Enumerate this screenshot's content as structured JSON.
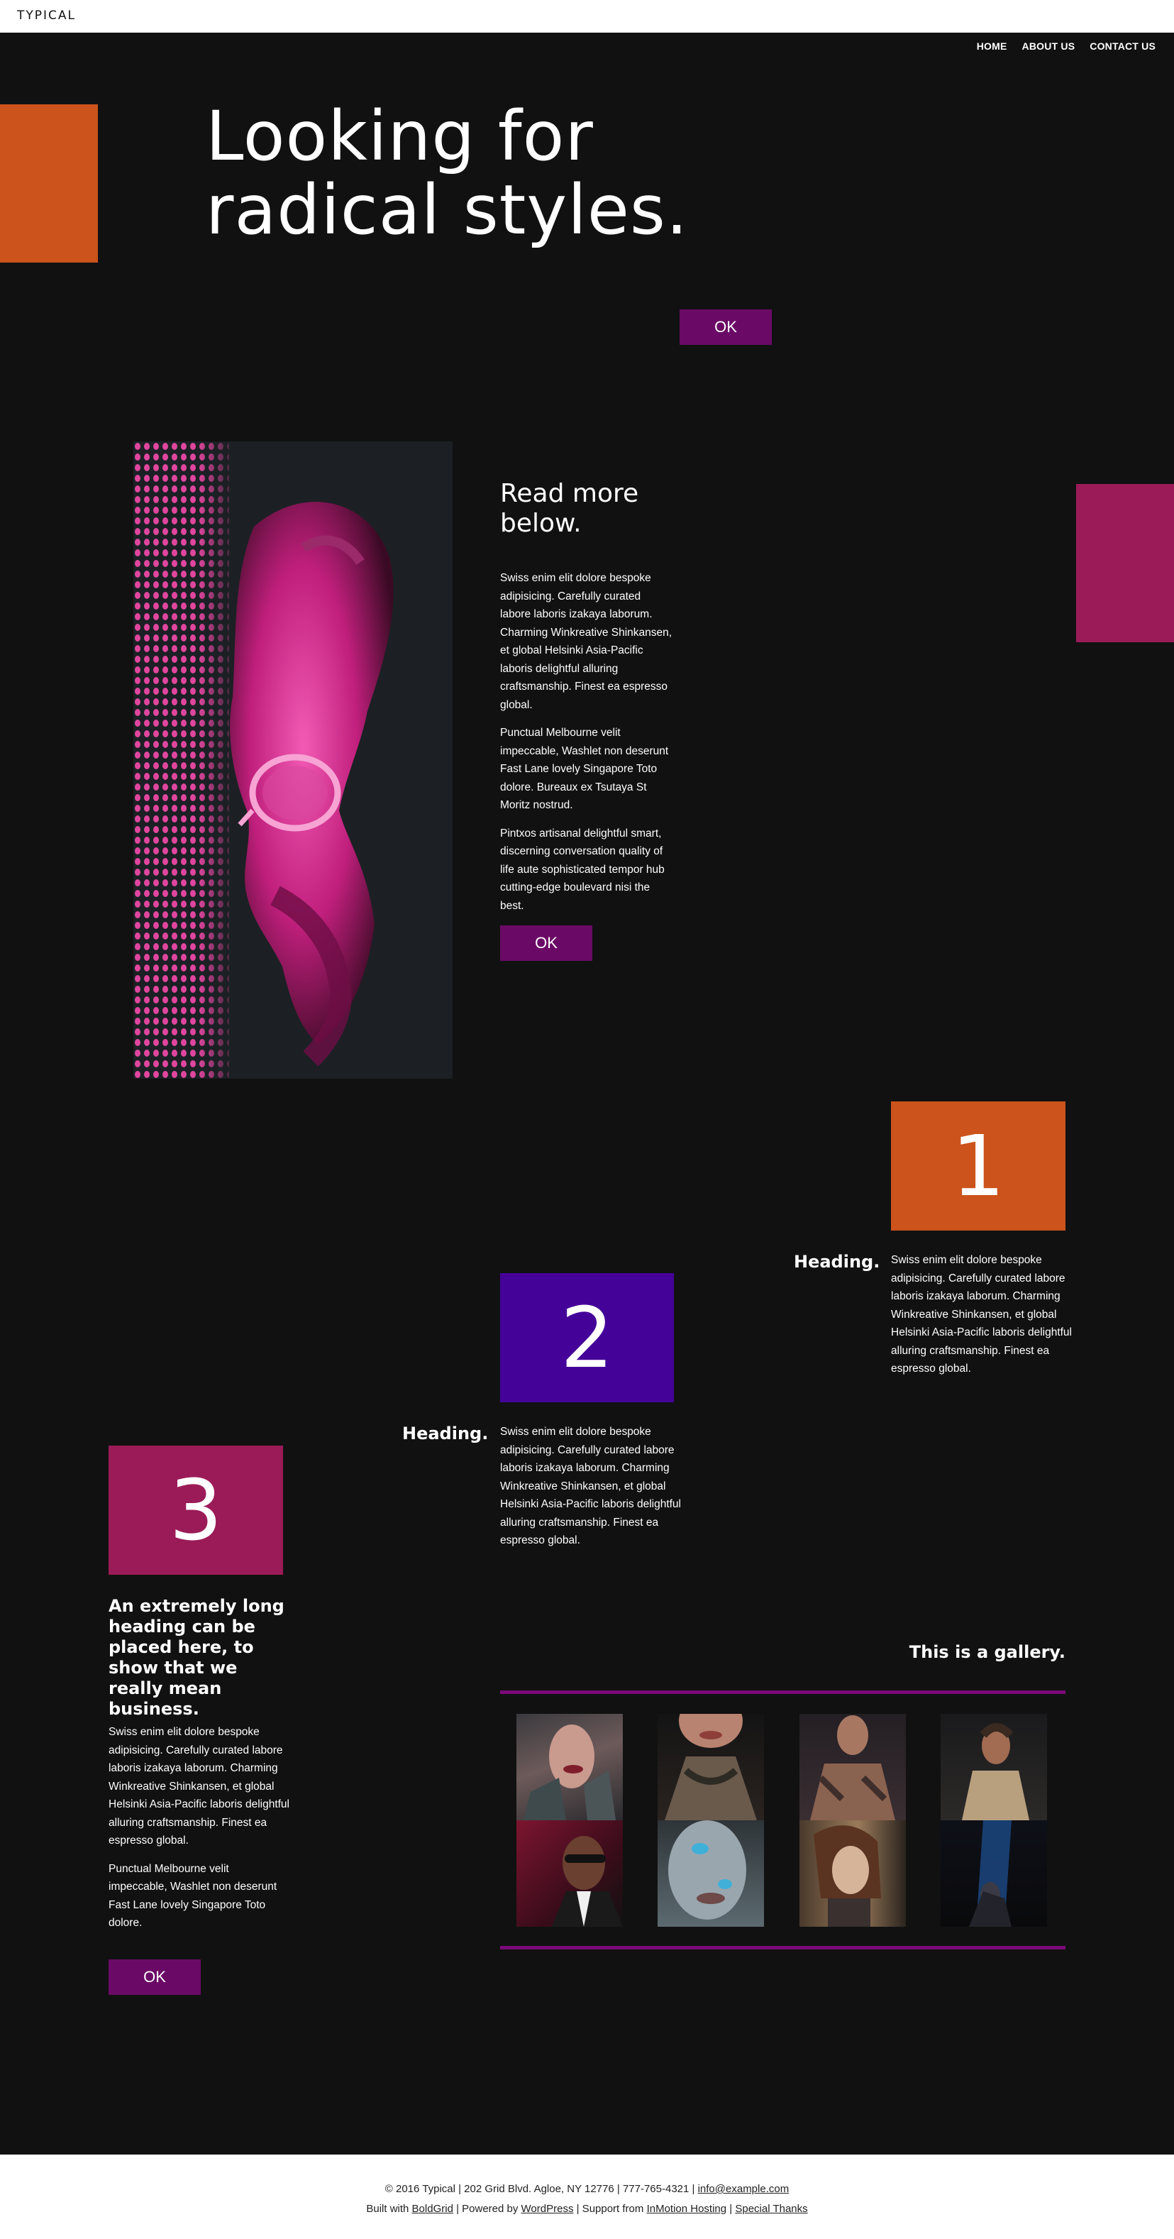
{
  "brand": "TYPICAL",
  "nav": {
    "home": "HOME",
    "about": "ABOUT US",
    "contact": "CONTACT US"
  },
  "hero": {
    "title_line1": "Looking for",
    "title_line2": "radical styles.",
    "button": "OK"
  },
  "about": {
    "heading_line1": "Read more",
    "heading_line2": "below.",
    "p1": "Swiss enim elit dolore bespoke adipisicing. Carefully curated labore laboris izakaya laborum. Charming Winkreative Shinkansen, et global Helsinki Asia-Pacific laboris delightful alluring craftsmanship. Finest ea espresso global.",
    "p2": "Punctual Melbourne velit impeccable, Washlet non deserunt Fast Lane lovely Singapore Toto dolore. Bureaux ex Tsutaya St Moritz nostrud.",
    "p3": "Pintxos artisanal delightful smart, discerning conversation quality of life aute sophisticated tempor hub cutting-edge boulevard nisi the best.",
    "button": "OK"
  },
  "steps": [
    {
      "number": "1",
      "heading": "Heading.",
      "text": "Swiss enim elit dolore bespoke adipisicing. Carefully curated labore laboris izakaya laborum. Charming Winkreative Shinkansen, et global Helsinki Asia-Pacific laboris delightful alluring craftsmanship. Finest ea espresso global."
    },
    {
      "number": "2",
      "heading": "Heading.",
      "text": "Swiss enim elit dolore bespoke adipisicing. Carefully curated labore laboris izakaya laborum. Charming Winkreative Shinkansen, et global Helsinki Asia-Pacific laboris delightful alluring craftsmanship. Finest ea espresso global."
    },
    {
      "number": "3",
      "heading": "An extremely long heading can be placed here, to show that we really mean business.",
      "p1": "Swiss enim elit dolore bespoke adipisicing. Carefully curated labore laboris izakaya laborum. Charming Winkreative Shinkansen, et global Helsinki Asia-Pacific laboris delightful alluring craftsmanship. Finest ea espresso global.",
      "p2": "Punctual Melbourne velit impeccable, Washlet non deserunt Fast Lane lovely Singapore Toto dolore.",
      "button": "OK"
    }
  ],
  "gallery": {
    "title": "This is a gallery."
  },
  "footer": {
    "line1_prefix": "© 2016 Typical | 202 Grid Blvd. Agloe, NY 12776 | 777-765-4321 | ",
    "email": "info@example.com",
    "built_with": "Built with ",
    "boldgrid": "BoldGrid",
    "powered_by": " | Powered by ",
    "wordpress": "WordPress",
    "support_from": " | Support from ",
    "inmotion": "InMotion Hosting",
    "sep": " | ",
    "thanks": "Special Thanks"
  },
  "colors": {
    "orange": "#cc531b",
    "pink": "#9b1b58",
    "purple": "#440299",
    "button": "#6a0a66",
    "rule": "#7a0a78"
  }
}
